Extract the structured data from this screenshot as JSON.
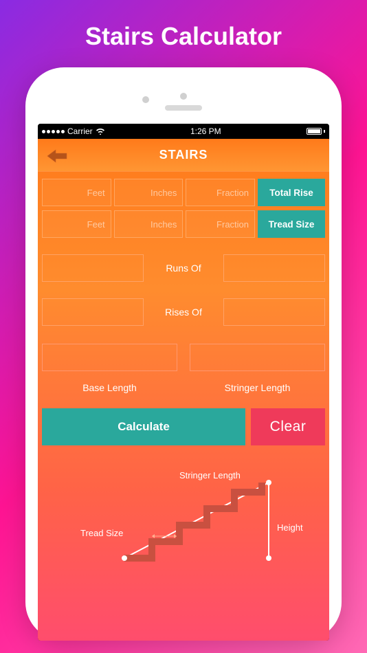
{
  "promo_title": "Stairs Calculator",
  "status": {
    "carrier": "Carrier",
    "time": "1:26 PM"
  },
  "nav": {
    "title": "STAIRS"
  },
  "inputs": {
    "row1": {
      "feet": "Feet",
      "inches": "Inches",
      "fraction": "Fraction",
      "tag": "Total Rise"
    },
    "row2": {
      "feet": "Feet",
      "inches": "Inches",
      "fraction": "Fraction",
      "tag": "Tread Size"
    }
  },
  "mid": {
    "runs": "Runs Of",
    "rises": "Rises Of"
  },
  "lengths": {
    "base": "Base Length",
    "stringer": "Stringer Length"
  },
  "buttons": {
    "calculate": "Calculate",
    "clear": "Clear"
  },
  "diagram": {
    "stringer": "Stringer Length",
    "tread": "Tread Size",
    "height": "Height"
  }
}
